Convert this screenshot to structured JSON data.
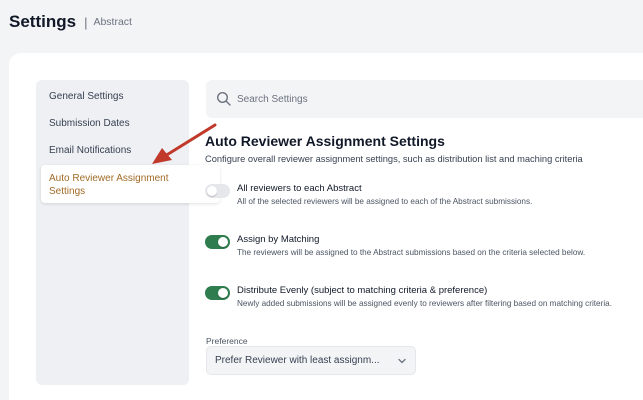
{
  "header": {
    "title": "Settings",
    "separator": "|",
    "breadcrumb": "Abstract"
  },
  "sidebar": {
    "items": [
      {
        "label": "General Settings"
      },
      {
        "label": "Submission Dates"
      },
      {
        "label": "Email Notifications"
      },
      {
        "label": "Auto Reviewer Assignment Settings",
        "active": true
      }
    ],
    "active_color": "#a16b26"
  },
  "search": {
    "placeholder": "Search Settings",
    "icon": "search-icon"
  },
  "main": {
    "title": "Auto Reviewer Assignment Settings",
    "description": "Configure overall reviewer assignment settings, such as distribution list and maching criteria",
    "options": [
      {
        "title": "All reviewers to each Abstract",
        "description": "All of the selected reviewers will be assigned to each of the Abstract submissions.",
        "enabled": false
      },
      {
        "title": "Assign by Matching",
        "description": "The reviewers will be assigned to the Abstract submissions based on the criteria selected below.",
        "enabled": true
      },
      {
        "title": "Distribute Evenly (subject to matching criteria & preference)",
        "description": "Newly added submissions will be assigned evenly to reviewers after filtering based on matching criteria.",
        "enabled": true
      }
    ],
    "toggle_on_color": "#2f7d4f",
    "preference": {
      "label": "Preference",
      "selected": "Prefer Reviewer with least assignm..."
    }
  },
  "annotation": {
    "arrow_color": "#c0392b"
  }
}
